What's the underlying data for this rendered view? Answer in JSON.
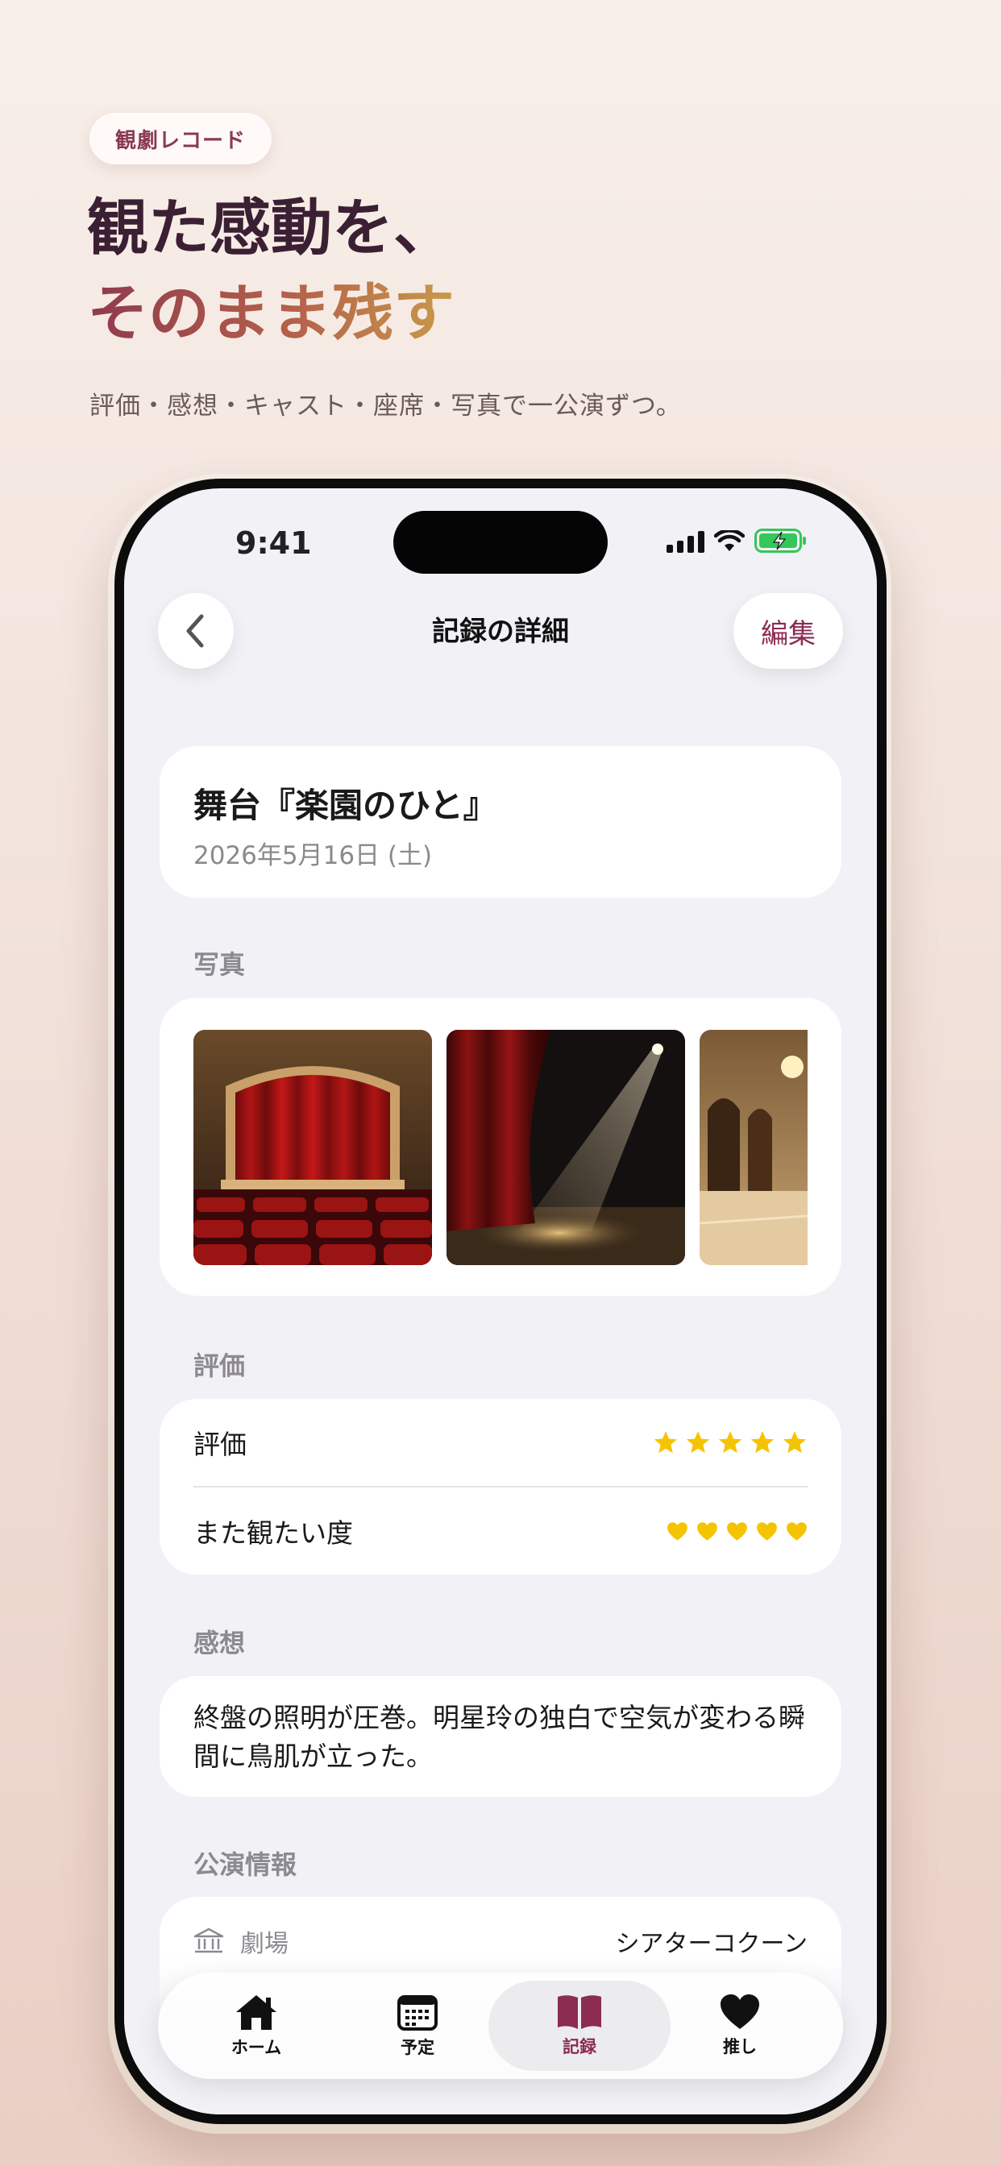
{
  "promo": {
    "badge": "観劇レコード",
    "headline_line1": "観た感動を、",
    "headline_line2": "そのまま残す",
    "subline": "評価・感想・キャスト・座席・写真で一公演ずつ。"
  },
  "status_bar": {
    "time": "9:41"
  },
  "nav": {
    "title": "記録の詳細",
    "edit_label": "編集"
  },
  "show": {
    "title": "舞台『楽園のひと』",
    "date": "2026年5月16日 (土)"
  },
  "photos_section": {
    "label": "写真",
    "photos": [
      "theater-stage-red-curtain",
      "spotlight-on-stage",
      "grand-lobby"
    ]
  },
  "rating_section": {
    "label": "評価",
    "rating_label": "評価",
    "rating_value": 5,
    "rating_max": 5,
    "rewatch_label": "また観たい度",
    "rewatch_value": 5,
    "rewatch_max": 5
  },
  "impression_section": {
    "label": "感想",
    "text": "終盤の照明が圧巻。明星玲の独白で空気が変わる瞬間に鳥肌が立った。"
  },
  "info_section": {
    "label": "公演情報",
    "venue_label": "劇場",
    "venue_value": "シアターコクーン"
  },
  "tabbar": {
    "items": [
      {
        "label": "ホーム",
        "icon": "house-icon"
      },
      {
        "label": "予定",
        "icon": "calendar-icon"
      },
      {
        "label": "記録",
        "icon": "book-icon"
      },
      {
        "label": "推し",
        "icon": "heart-icon"
      }
    ],
    "active_index": 2
  },
  "colors": {
    "accent": "#8b2c50",
    "star": "#f5c400",
    "battery": "#34c759"
  }
}
